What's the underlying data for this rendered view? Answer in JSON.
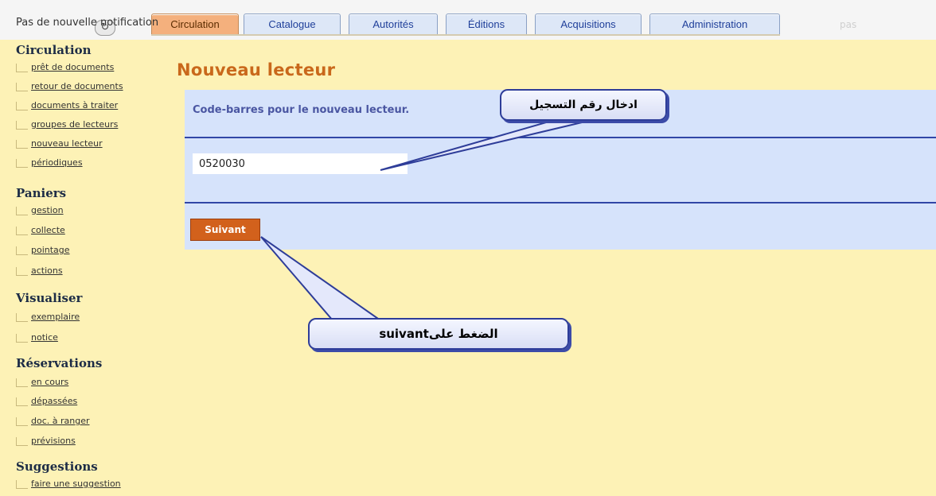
{
  "topbar": {
    "notification": "Pas de nouvelle notification",
    "refresh_icon": "refresh-icon",
    "faded_text": "pas",
    "tabs": [
      {
        "label": "Circulation",
        "active": true
      },
      {
        "label": "Catalogue",
        "active": false
      },
      {
        "label": "Autorités",
        "active": false
      },
      {
        "label": "Éditions",
        "active": false
      },
      {
        "label": "Acquisitions",
        "active": false
      },
      {
        "label": "Administration",
        "active": false
      }
    ]
  },
  "sidebar": {
    "sections": [
      {
        "title": "Circulation",
        "items": [
          "prêt de documents",
          "retour de documents",
          "documents à traiter",
          "groupes de lecteurs",
          "nouveau lecteur",
          "périodiques"
        ]
      },
      {
        "title": "Paniers",
        "items": [
          "gestion",
          "collecte",
          "pointage",
          "actions"
        ]
      },
      {
        "title": "Visualiser",
        "items": [
          "exemplaire",
          "notice"
        ]
      },
      {
        "title": "Réservations",
        "items": [
          "en cours",
          "dépassées",
          "doc. à ranger",
          "prévisions"
        ]
      },
      {
        "title": "Suggestions",
        "items": [
          "faire une suggestion"
        ]
      }
    ]
  },
  "main": {
    "title": "Nouveau lecteur",
    "form_label": "Code-barres pour le nouveau lecteur.",
    "barcode_value": "0520030",
    "submit_label": "Suivant"
  },
  "annotations": {
    "top": "ادخال رقم التسجيل",
    "bottom": "suivantالضغط على"
  },
  "colors": {
    "page_background": "#fdf2b6",
    "form_background": "#d6e3fb",
    "title_orange": "#c9681b",
    "button_orange": "#d2611c",
    "rule_blue": "#3146a6",
    "callout_border": "#2e3d99"
  }
}
